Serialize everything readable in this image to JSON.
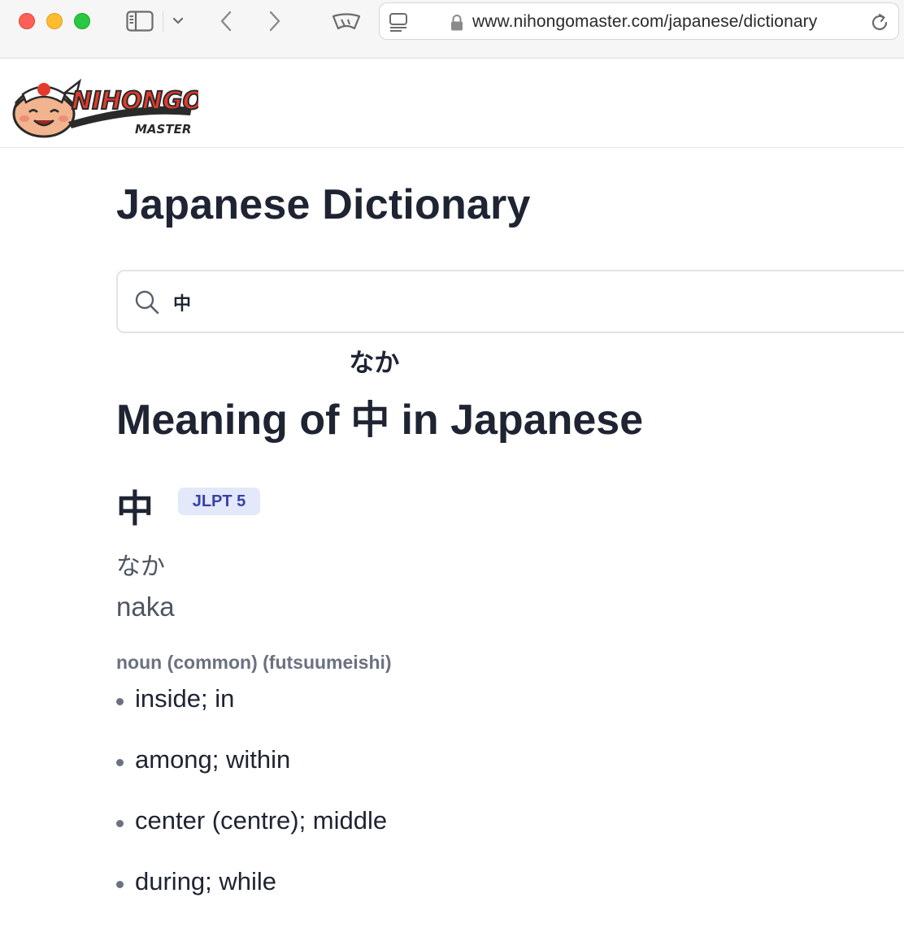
{
  "browser": {
    "url": "www.nihongomaster.com/japanese/dictionary"
  },
  "site": {
    "logo_text": "NIHONGO",
    "logo_subtext": "MASTER"
  },
  "page": {
    "title": "Japanese Dictionary"
  },
  "search": {
    "value": "中"
  },
  "heading": {
    "prefix": "Meaning of",
    "word": "中",
    "furigana": "なか",
    "suffix": "in Japanese"
  },
  "entry": {
    "kanji": "中",
    "jlpt": "JLPT 5",
    "kana": "なか",
    "romaji": "naka",
    "part_of_speech": "noun (common) (futsuumeishi)",
    "meanings": [
      "inside; in",
      "among; within",
      "center (centre); middle",
      "during; while"
    ]
  },
  "colors": {
    "badge_bg": "#e3e8fb",
    "badge_text": "#3840a8",
    "title_text": "#1f2433",
    "muted_text": "#6b7180"
  }
}
